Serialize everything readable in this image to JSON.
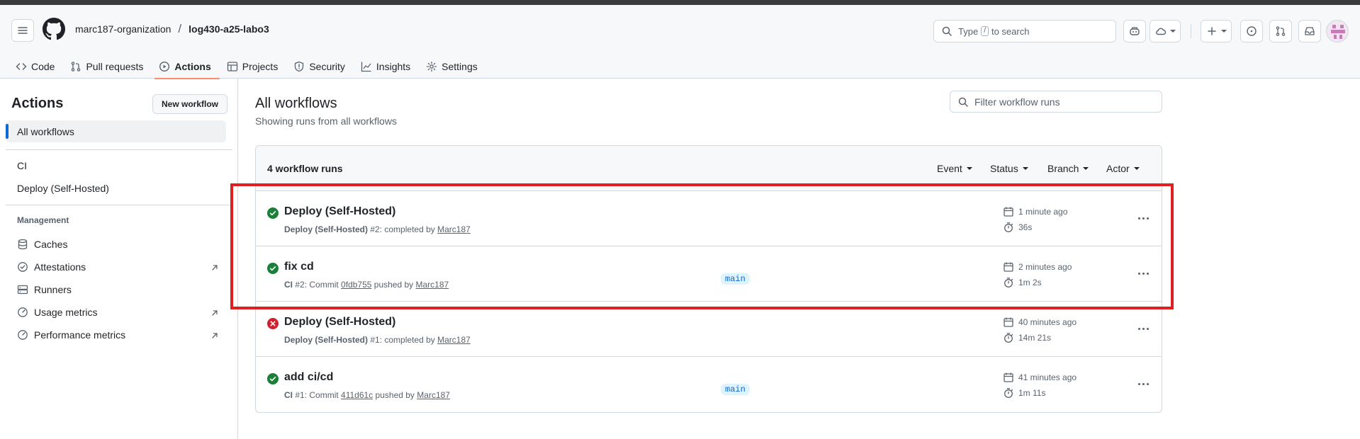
{
  "breadcrumb": {
    "org": "marc187-organization",
    "sep": "/",
    "repo": "log430-a25-labo3"
  },
  "search": {
    "prefix": "Type",
    "key": "/",
    "suffix": "to search"
  },
  "tabs": [
    {
      "label": "Code",
      "icon": "code-icon"
    },
    {
      "label": "Pull requests",
      "icon": "git-pull-request-icon"
    },
    {
      "label": "Actions",
      "icon": "play-icon",
      "active": true
    },
    {
      "label": "Projects",
      "icon": "table-icon"
    },
    {
      "label": "Security",
      "icon": "shield-icon"
    },
    {
      "label": "Insights",
      "icon": "graph-icon"
    },
    {
      "label": "Settings",
      "icon": "gear-icon"
    }
  ],
  "sidebar": {
    "title": "Actions",
    "new_workflow": "New workflow",
    "all_workflows": "All workflows",
    "workflows": [
      "CI",
      "Deploy (Self-Hosted)"
    ],
    "management_heading": "Management",
    "management": [
      {
        "label": "Caches",
        "icon": "database-icon"
      },
      {
        "label": "Attestations",
        "icon": "verified-icon",
        "external": true
      },
      {
        "label": "Runners",
        "icon": "server-icon"
      },
      {
        "label": "Usage metrics",
        "icon": "meter-icon",
        "external": true
      },
      {
        "label": "Performance metrics",
        "icon": "meter-icon",
        "external": true
      }
    ]
  },
  "main": {
    "title": "All workflows",
    "subtitle": "Showing runs from all workflows",
    "filter_placeholder": "Filter workflow runs",
    "runs_count": "4 workflow runs",
    "filters": [
      "Event",
      "Status",
      "Branch",
      "Actor"
    ],
    "runs": [
      {
        "status": "success",
        "title": "Deploy (Self-Hosted)",
        "workflow": "Deploy (Self-Hosted)",
        "number": "#2",
        "action": ": completed by",
        "commit": "",
        "actor": "Marc187",
        "branch": "",
        "when": "1 minute ago",
        "duration": "36s"
      },
      {
        "status": "success",
        "title": "fix cd",
        "workflow": "CI",
        "number": "#2",
        "action": ": Commit",
        "commit": "0fdb755",
        "pushed": "pushed by",
        "actor": "Marc187",
        "branch": "main",
        "when": "2 minutes ago",
        "duration": "1m 2s"
      },
      {
        "status": "failure",
        "title": "Deploy (Self-Hosted)",
        "workflow": "Deploy (Self-Hosted)",
        "number": "#1",
        "action": ": completed by",
        "commit": "",
        "actor": "Marc187",
        "branch": "",
        "when": "40 minutes ago",
        "duration": "14m 21s"
      },
      {
        "status": "success",
        "title": "add ci/cd",
        "workflow": "CI",
        "number": "#1",
        "action": ": Commit",
        "commit": "411d61c",
        "pushed": "pushed by",
        "actor": "Marc187",
        "branch": "main",
        "when": "41 minutes ago",
        "duration": "1m 11s"
      }
    ]
  },
  "colors": {
    "success": "#1a7f37",
    "failure": "#cf222e",
    "accent": "#0969da",
    "tab_underline": "#fd8c73",
    "highlight": "#e02020"
  }
}
